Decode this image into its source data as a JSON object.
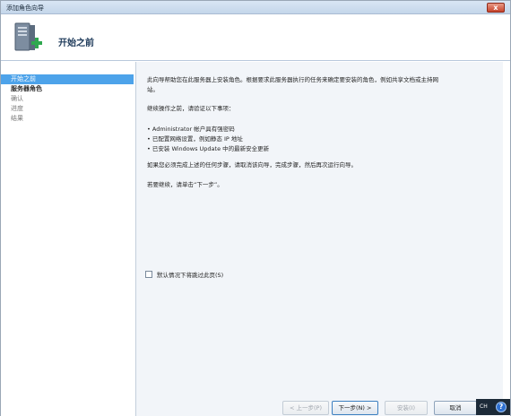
{
  "window": {
    "title": "添加角色向导",
    "close_glyph": "x"
  },
  "header": {
    "title": "开始之前",
    "icon": "server-add-icon"
  },
  "nav": {
    "items": [
      {
        "label": "开始之前",
        "state": "selected"
      },
      {
        "label": "服务器角色",
        "state": "bold"
      },
      {
        "label": "确认",
        "state": "normal"
      },
      {
        "label": "进度",
        "state": "normal"
      },
      {
        "label": "结果",
        "state": "normal"
      }
    ]
  },
  "main": {
    "intro_line1": "此向导帮助您在此服务器上安装角色。根据要求此服务器执行的任务来确定要安装的角色，例如共享文档或主持网",
    "intro_line2": "站。",
    "verify": "继续操作之前，请验证以下事项：",
    "bullets": [
      "• Administrator 帐户具有强密码",
      "• 已配置网络设置，例如静态 IP 地址",
      "• 已安装 Windows Update 中的最新安全更新"
    ],
    "if_not": "如果您必须完成上述的任何步骤，请取消该向导，完成步骤，然后再次运行向导。",
    "continue": "若要继续，请单击“下一步”。",
    "skip_checkbox_label": "默认情况下将跳过此页(S)"
  },
  "buttons": {
    "prev": "< 上一步(P)",
    "next": "下一步(N) >",
    "install": "安装(I)",
    "cancel": "取消"
  },
  "tray": {
    "lang": "CH",
    "help": "?"
  }
}
